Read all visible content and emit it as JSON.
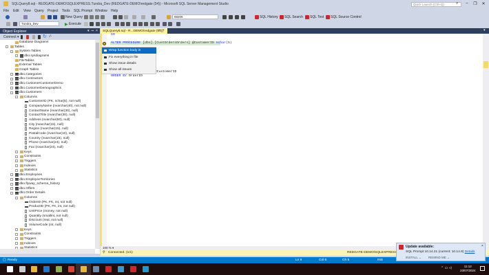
{
  "window": {
    "title": "SQLQuery8.sql - REDGATE-DEMO\\SQLEXPRESS.Tundra_Dev (REDGATE-DEMO\\redgate (54)) - Microsoft SQL Server Management Studio",
    "quick_launch_placeholder": "Quick Launch (Ctrl+Q)"
  },
  "menu": [
    "File",
    "Edit",
    "View",
    "Query",
    "Project",
    "Tools",
    "SQL Prompt",
    "Window",
    "Help"
  ],
  "toolbar": {
    "new_query": "New Query",
    "execute": "Execute",
    "database": "Tundra_Dev",
    "search_combo": "88206",
    "sql_history": "SQL History",
    "sql_search": "SQL Search",
    "sql_test": "SQL Test",
    "sql_source_control": "SQL Source Control"
  },
  "object_explorer": {
    "title": "Object Explorer",
    "connect": "Connect ▾",
    "tree": [
      {
        "l": "Database Diagrams",
        "d": 4,
        "i": "folder"
      },
      {
        "l": "Tables",
        "d": 3,
        "i": "folder",
        "e": "-"
      },
      {
        "l": "System Tables",
        "d": 4,
        "i": "folder",
        "e": "-"
      },
      {
        "l": "dbo.sysdiagrams",
        "d": 5,
        "i": "table",
        "e": "+"
      },
      {
        "l": "FileTables",
        "d": 4,
        "i": "folder"
      },
      {
        "l": "External Tables",
        "d": 4,
        "i": "folder"
      },
      {
        "l": "Graph Tables",
        "d": 4,
        "i": "folder"
      },
      {
        "l": "dbo.Categories",
        "d": 4,
        "i": "table",
        "e": "+"
      },
      {
        "l": "dbo.Contractors",
        "d": 4,
        "i": "table",
        "e": "+"
      },
      {
        "l": "dbo.CustomerCustomerDemo",
        "d": 4,
        "i": "table",
        "e": "+"
      },
      {
        "l": "dbo.CustomerDemographics",
        "d": 4,
        "i": "table",
        "e": "+"
      },
      {
        "l": "dbo.Customers",
        "d": 4,
        "i": "table",
        "e": "-"
      },
      {
        "l": "Columns",
        "d": 5,
        "i": "folder",
        "e": "-"
      },
      {
        "l": "CustomerID (PK, nchar(5), not null)",
        "d": 6,
        "i": "key"
      },
      {
        "l": "CompanyName (nvarchar(40), not null)",
        "d": 6,
        "i": "col"
      },
      {
        "l": "ContactName (nvarchar(30), null)",
        "d": 6,
        "i": "col"
      },
      {
        "l": "ContactTitle (nvarchar(30), null)",
        "d": 6,
        "i": "col"
      },
      {
        "l": "Address (nvarchar(60), null)",
        "d": 6,
        "i": "col"
      },
      {
        "l": "City (nvarchar(15), null)",
        "d": 6,
        "i": "col"
      },
      {
        "l": "Region (nvarchar(15), null)",
        "d": 6,
        "i": "col"
      },
      {
        "l": "PostalCode (nvarchar(10), null)",
        "d": 6,
        "i": "col"
      },
      {
        "l": "Country (nvarchar(15), null)",
        "d": 6,
        "i": "col"
      },
      {
        "l": "Phone (nvarchar(24), null)",
        "d": 6,
        "i": "col"
      },
      {
        "l": "Fax (nvarchar(24), null)",
        "d": 6,
        "i": "col"
      },
      {
        "l": "Keys",
        "d": 5,
        "i": "folder",
        "e": "+"
      },
      {
        "l": "Constraints",
        "d": 5,
        "i": "folder",
        "e": "+"
      },
      {
        "l": "Triggers",
        "d": 5,
        "i": "folder",
        "e": "+"
      },
      {
        "l": "Indexes",
        "d": 5,
        "i": "folder",
        "e": "+"
      },
      {
        "l": "Statistics",
        "d": 5,
        "i": "folder",
        "e": "+"
      },
      {
        "l": "dbo.Employees",
        "d": 4,
        "i": "table",
        "e": "+"
      },
      {
        "l": "dbo.EmployeeTerritories",
        "d": 4,
        "i": "table",
        "e": "+"
      },
      {
        "l": "dbo.flyway_schema_history",
        "d": 4,
        "i": "table",
        "e": "+"
      },
      {
        "l": "dbo.Offers",
        "d": 4,
        "i": "table",
        "e": "+"
      },
      {
        "l": "dbo.Order Details",
        "d": 4,
        "i": "table",
        "e": "-"
      },
      {
        "l": "Columns",
        "d": 5,
        "i": "folder",
        "e": "-"
      },
      {
        "l": "OrderID (PK, FK, int, not null)",
        "d": 6,
        "i": "key"
      },
      {
        "l": "ProductID (PK, FK, int, not null)",
        "d": 6,
        "i": "key"
      },
      {
        "l": "UnitPrice (money, not null)",
        "d": 6,
        "i": "col"
      },
      {
        "l": "Quantity (smallint, not null)",
        "d": 6,
        "i": "col"
      },
      {
        "l": "Discount (real, not null)",
        "d": 6,
        "i": "col"
      },
      {
        "l": "VolumeCode (int, null)",
        "d": 6,
        "i": "col"
      },
      {
        "l": "Keys",
        "d": 5,
        "i": "folder",
        "e": "+"
      },
      {
        "l": "Constraints",
        "d": 5,
        "i": "folder",
        "e": "+"
      },
      {
        "l": "Triggers",
        "d": 5,
        "i": "folder",
        "e": "+"
      },
      {
        "l": "Indexes",
        "d": 5,
        "i": "folder",
        "e": "+"
      },
      {
        "l": "Statistics",
        "d": 5,
        "i": "folder",
        "e": "-"
      }
    ]
  },
  "editor": {
    "tab_title": "SQLQuery8.sql - R...DEMO\\redgate (54))",
    "tab_pin": "⊸",
    "tab_close": "×",
    "code": {
      "go": "GO",
      "alter_kw": "ALTER PROCEDURE",
      "alter_obj": " [dbo].[CustOrdersOrders] @CustomerID ",
      "alter_type": "nchar",
      "alter_end": "(5)",
      "where_line": "WHERE CustomerID = @CustomerID",
      "order_kw": "ORDER BY",
      "order_col": " OrderID"
    },
    "quick_fix_menu": [
      "Wrap function body in BEGIN/END",
      "Fix everything in file",
      "Show issue details",
      "Show all issues"
    ],
    "zoom": "100 %",
    "connection_status": "Connected. (1/1)",
    "server": "REDGATE-DEMO\\SQLEXPRESS (15..."
  },
  "status_bar": {
    "ready": "Ready",
    "ln": "Ln 9",
    "col": "Col 5",
    "ch": "Ch 5",
    "mode": "INS"
  },
  "notification": {
    "title": "Update available:",
    "message": "SQL Prompt 10.14.21 (current: 10.14.8)",
    "details_link": "Details",
    "install": "INSTALL ⌄",
    "remind": "REMIND ME ⌄"
  },
  "taskbar": {
    "icons": [
      "windows-start",
      "file-explorer-alt",
      "file-explorer",
      "visual-studio-code",
      "notepad",
      "chrome",
      "ssms",
      "postgresql",
      "redgate-flyway",
      "remote-desktop",
      "redgate-app",
      "edge"
    ],
    "time": "11:12",
    "date": "23/07/2024"
  },
  "colors": {
    "accent": "#007acc",
    "tab_active": "#fff29d",
    "panel_header": "#2d3e5f"
  }
}
